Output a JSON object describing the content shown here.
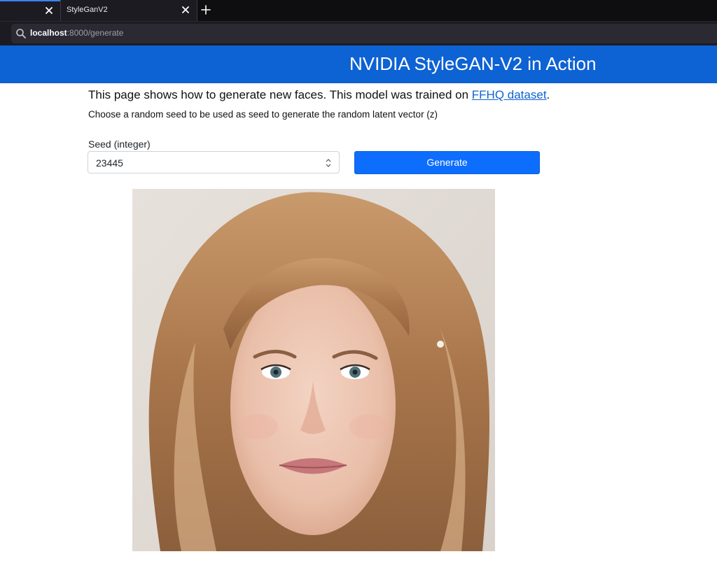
{
  "browser": {
    "tabs": [
      {
        "title": ""
      },
      {
        "title": "StyleGanV2"
      }
    ],
    "url": {
      "host": "localhost",
      "path": ":8000/generate"
    }
  },
  "header": {
    "title": "NVIDIA StyleGAN-V2 in Action"
  },
  "intro": {
    "text_before": "This page shows how to generate new faces. This model was trained on ",
    "link_text": "FFHQ dataset",
    "text_after": "."
  },
  "subtext": "Choose a random seed to be used as seed to generate the random latent vector (z)",
  "form": {
    "seed_label": "Seed (integer)",
    "seed_value": "23445",
    "generate_label": "Generate"
  },
  "colors": {
    "header_bg": "#0d62d4",
    "button_bg": "#0d6efd",
    "link": "#0d62d4"
  },
  "icons": {
    "tab_close": "close-icon",
    "new_tab": "plus-icon",
    "url_search": "search-icon",
    "number_spinner": "spinner-arrows-icon"
  }
}
